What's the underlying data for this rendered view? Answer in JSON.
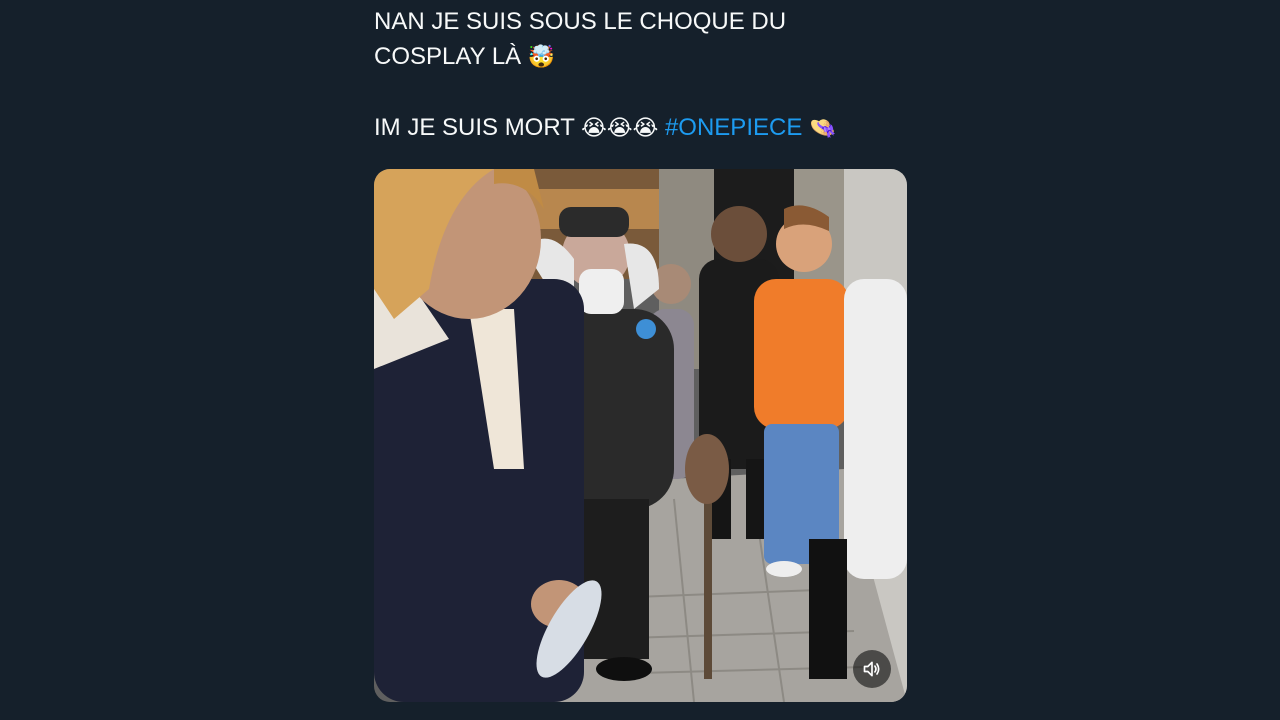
{
  "tweet": {
    "line1": "NAN JE SUIS SOUS LE CHOQUE DU",
    "line2": "COSPLAY LÀ",
    "line2_emoji": "🤯",
    "line3": "IM JE SUIS MORT",
    "line3_emojis": "😭😭😭",
    "hashtag": "#ONEPIECE",
    "hashtag_emoji": "👒"
  },
  "media": {
    "type": "video",
    "volume_icon": "speaker-icon"
  },
  "colors": {
    "background": "#15202b",
    "text": "#f7f9f9",
    "link": "#1d9bf0"
  }
}
